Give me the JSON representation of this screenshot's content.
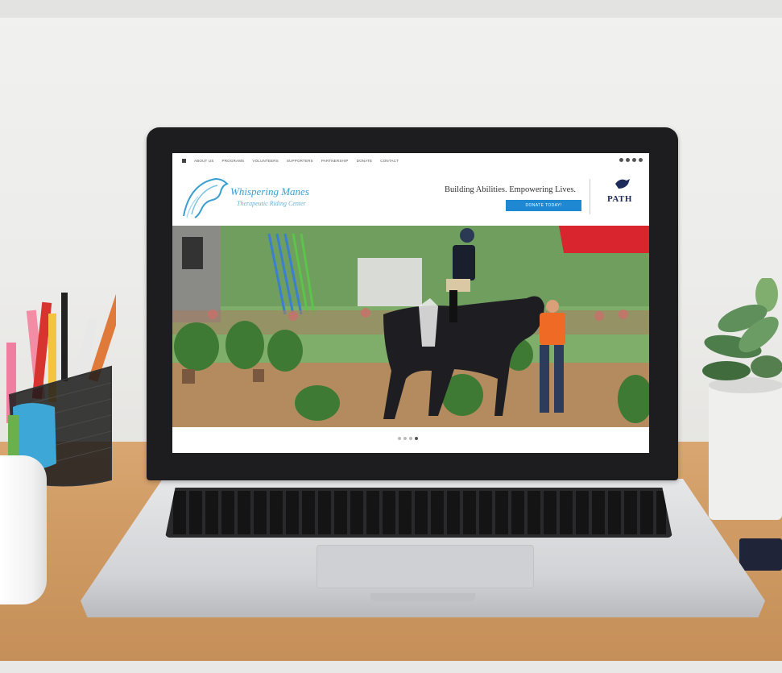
{
  "website": {
    "nav_items": [
      "ABOUT US",
      "PROGRAMS",
      "VOLUNTEERS",
      "SUPPORTERS",
      "PARTNERSHIP",
      "DONATE",
      "CONTACT"
    ],
    "logo_name": "Whispering Manes",
    "logo_subtitle": "Therapeutic Riding Center",
    "tagline": "Building Abilities. Empowering Lives.",
    "donate_button": "DONATE TODAY!",
    "partner_badge": "PATH",
    "slider_dots": 4,
    "active_dot": 3
  },
  "colors": {
    "brand_blue": "#3a9fd0",
    "donate_blue": "#1e88d2",
    "path_navy": "#1d2b5b",
    "laptop_bezel": "#1d1d1f",
    "desk_wood": "#cf9a63"
  }
}
